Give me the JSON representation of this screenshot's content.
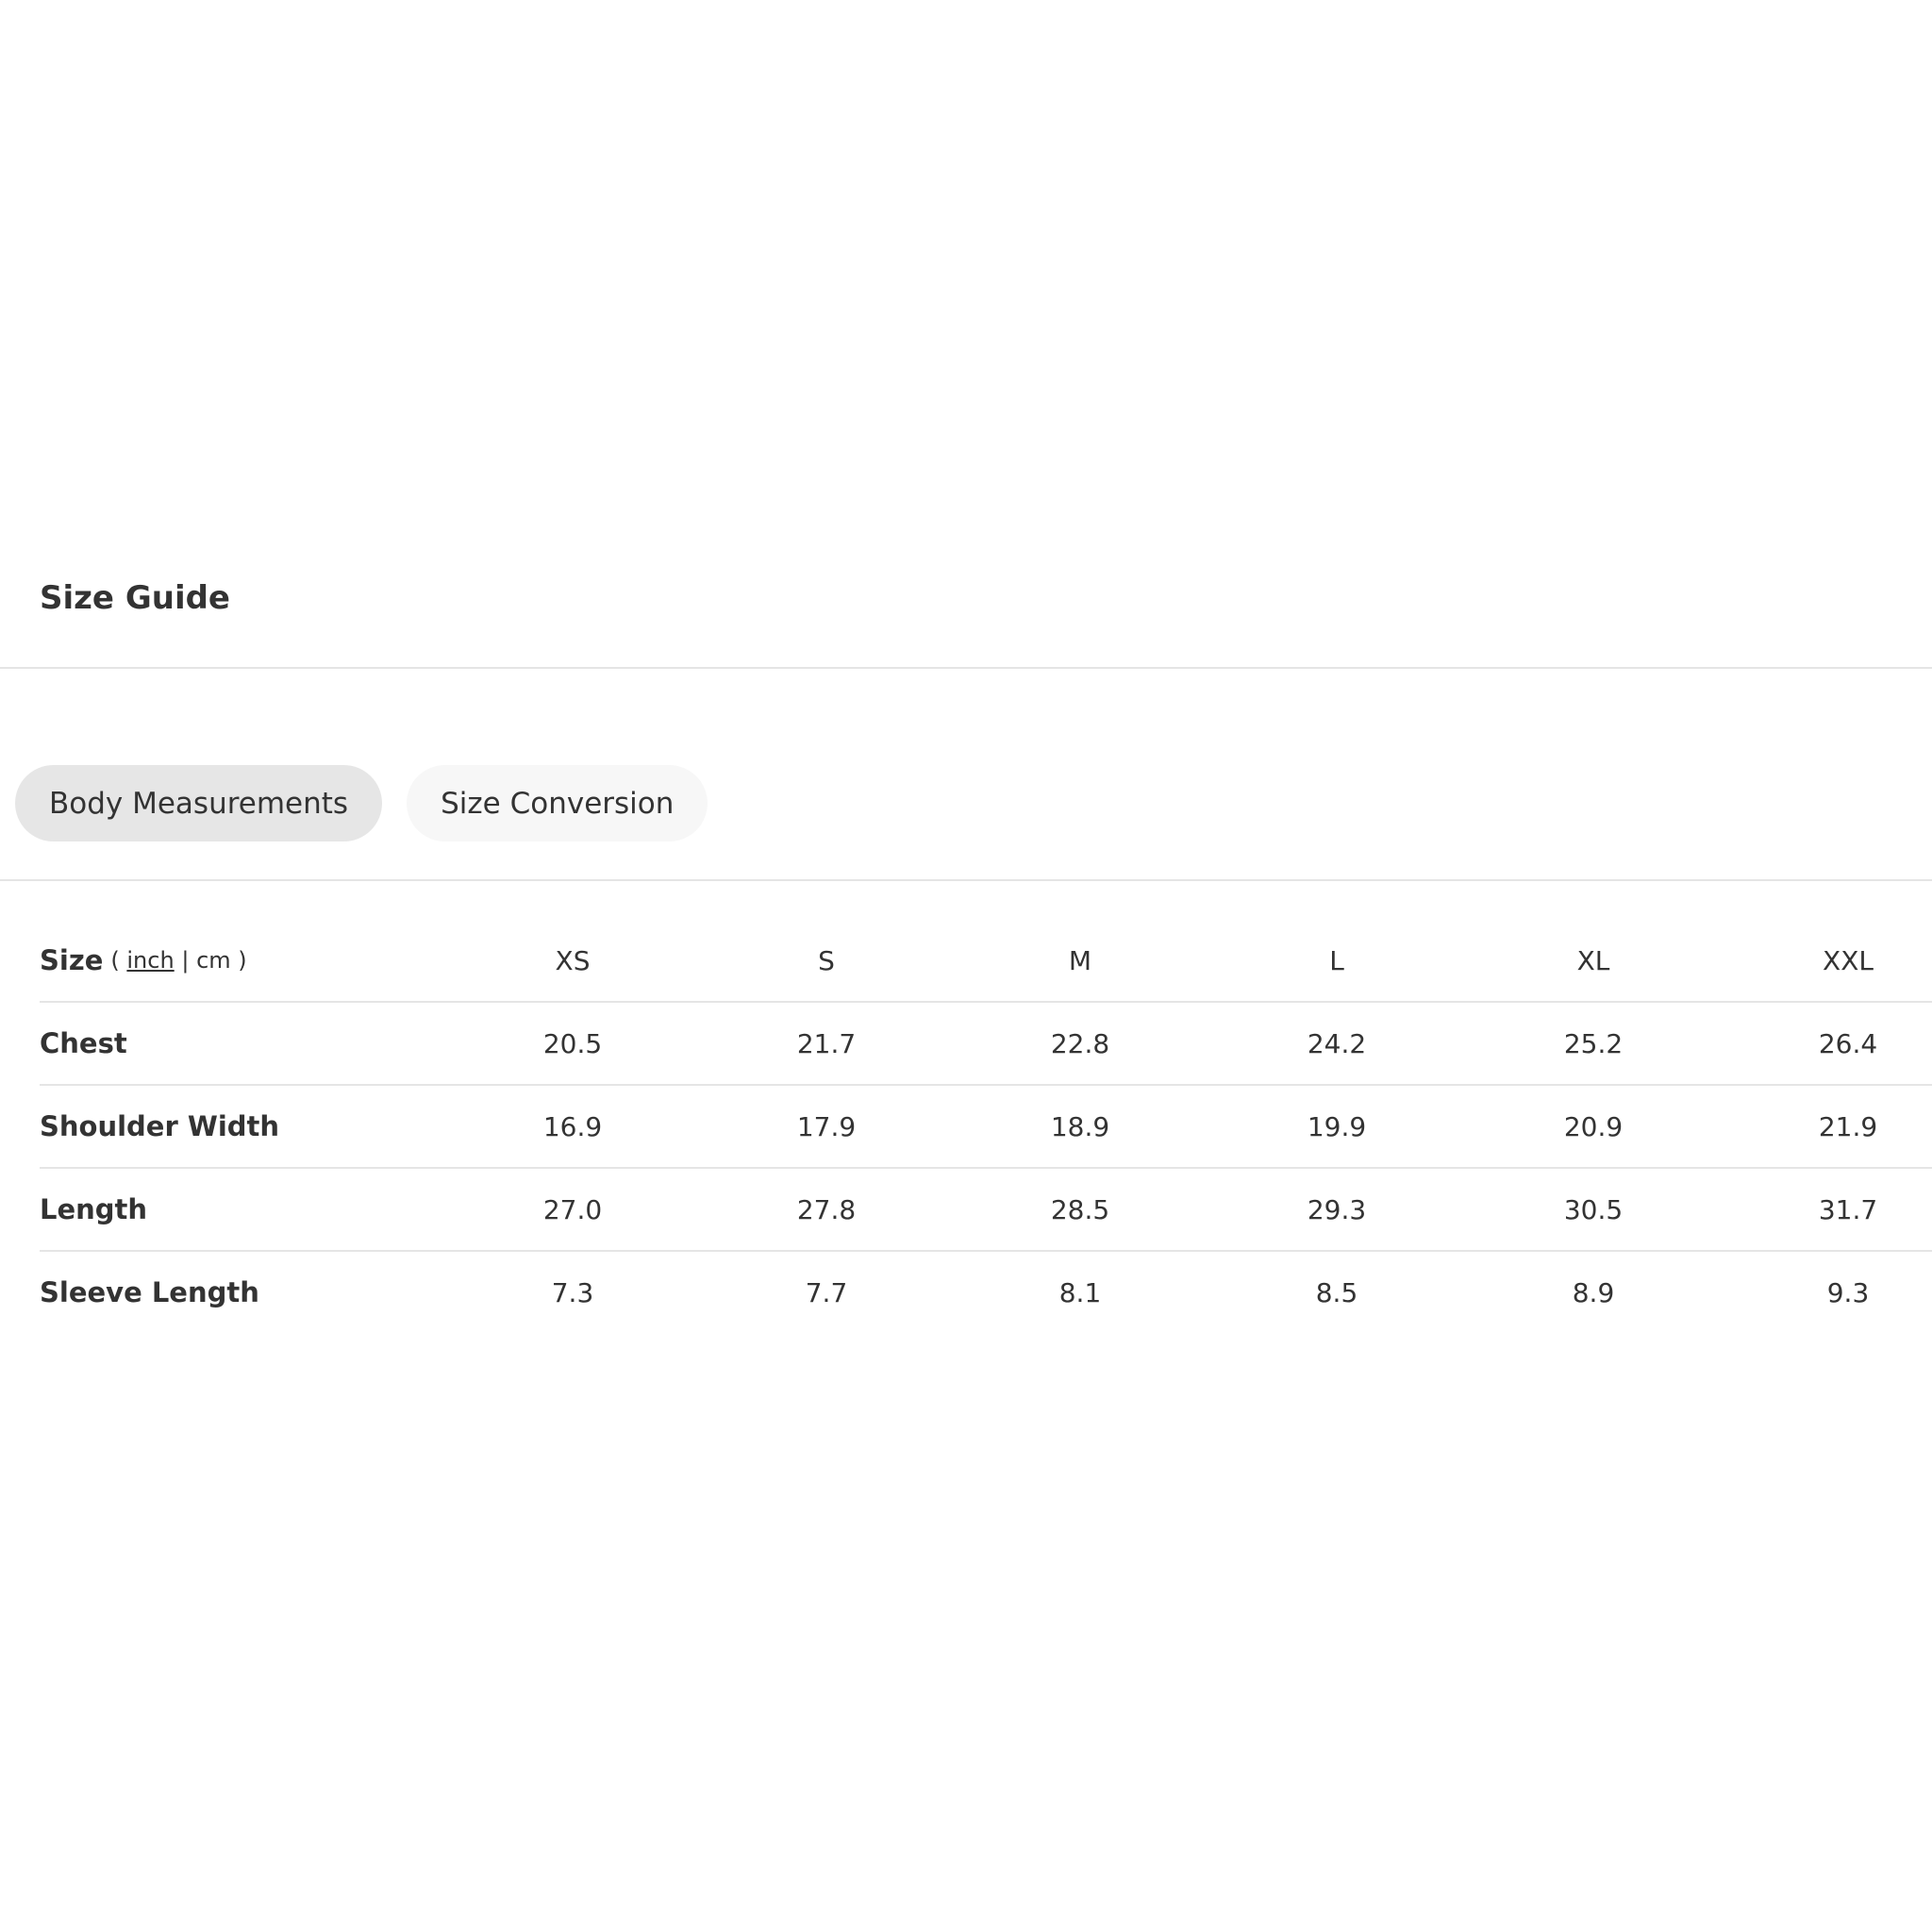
{
  "header": {
    "title": "Size Guide"
  },
  "tabs": [
    {
      "label": "Body Measurements",
      "active": true
    },
    {
      "label": "Size Conversion",
      "active": false
    }
  ],
  "table": {
    "header": {
      "label": "Size",
      "unit_open": "(",
      "unit_inch": "inch",
      "unit_sep": "|",
      "unit_cm": "cm",
      "unit_close": ")",
      "selected_unit": "inch",
      "sizes": [
        "XS",
        "S",
        "M",
        "L",
        "XL",
        "XXL"
      ]
    },
    "rows": [
      {
        "label": "Chest",
        "values": [
          "20.5",
          "21.7",
          "22.8",
          "24.2",
          "25.2",
          "26.4"
        ]
      },
      {
        "label": "Shoulder Width",
        "values": [
          "16.9",
          "17.9",
          "18.9",
          "19.9",
          "20.9",
          "21.9"
        ]
      },
      {
        "label": "Length",
        "values": [
          "27.0",
          "27.8",
          "28.5",
          "29.3",
          "30.5",
          "31.7"
        ]
      },
      {
        "label": "Sleeve Length",
        "values": [
          "7.3",
          "7.7",
          "8.1",
          "8.5",
          "8.9",
          "9.3"
        ]
      }
    ]
  },
  "colors": {
    "text": "#333333",
    "divider": "#e5e5e5",
    "tab_active_bg": "#e6e6e6",
    "tab_inactive_bg": "#f7f7f7"
  }
}
